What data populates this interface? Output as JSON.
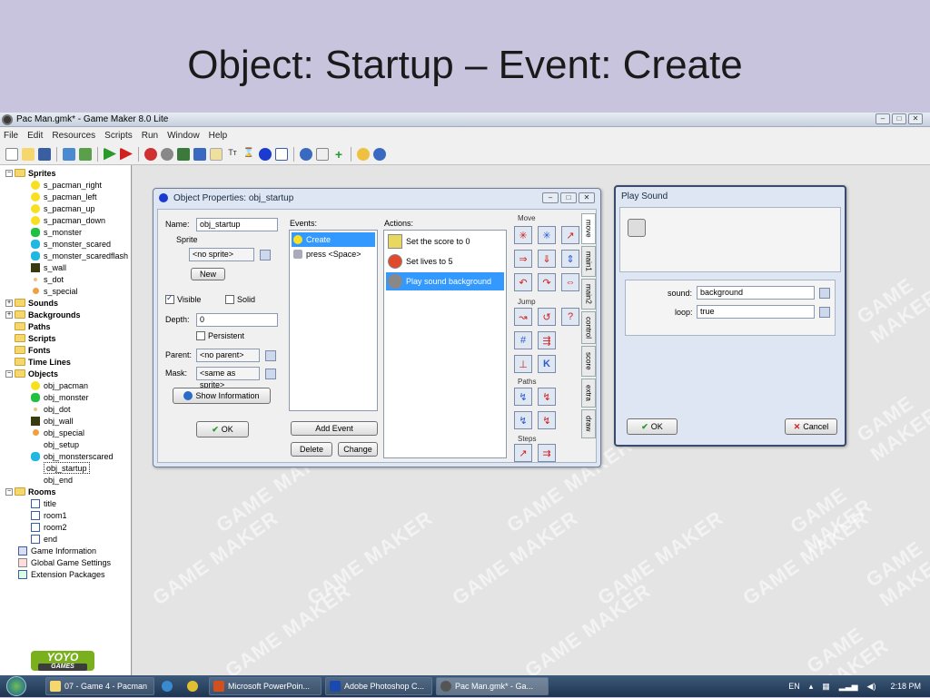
{
  "slide": {
    "title": "Object: Startup – Event: Create"
  },
  "window": {
    "title": "Pac Man.gmk* - Game Maker 8.0 Lite"
  },
  "menu": [
    "File",
    "Edit",
    "Resources",
    "Scripts",
    "Run",
    "Window",
    "Help"
  ],
  "tree": {
    "sprites_label": "Sprites",
    "sprites": [
      "s_pacman_right",
      "s_pacman_left",
      "s_pacman_up",
      "s_pacman_down",
      "s_monster",
      "s_monster_scared",
      "s_monster_scaredflash",
      "s_wall",
      "s_dot",
      "s_special"
    ],
    "sounds_label": "Sounds",
    "backgrounds_label": "Backgrounds",
    "paths_label": "Paths",
    "scripts_label": "Scripts",
    "fonts_label": "Fonts",
    "timelines_label": "Time Lines",
    "objects_label": "Objects",
    "objects": [
      "obj_pacman",
      "obj_monster",
      "obj_dot",
      "obj_wall",
      "obj_special",
      "obj_setup",
      "obj_monsterscared",
      "obj_startup",
      "obj_end"
    ],
    "rooms_label": "Rooms",
    "rooms": [
      "title",
      "room1",
      "room2",
      "end"
    ],
    "extras": [
      "Game Information",
      "Global Game Settings",
      "Extension Packages"
    ]
  },
  "objdlg": {
    "title": "Object Properties: obj_startup",
    "name_label": "Name:",
    "name_value": "obj_startup",
    "sprite_label": "Sprite",
    "sprite_value": "<no sprite>",
    "new_btn": "New",
    "visible_label": "Visible",
    "solid_label": "Solid",
    "depth_label": "Depth:",
    "depth_value": "0",
    "persistent_label": "Persistent",
    "parent_label": "Parent:",
    "parent_value": "<no parent>",
    "mask_label": "Mask:",
    "mask_value": "<same as sprite>",
    "show_info_btn": "Show Information",
    "ok_btn": "OK",
    "events_label": "Events:",
    "events": [
      "Create",
      "press <Space>"
    ],
    "add_event_btn": "Add Event",
    "delete_btn": "Delete",
    "change_btn": "Change",
    "actions_label": "Actions:",
    "actions": [
      "Set the score to 0",
      "Set lives to 5",
      "Play sound background"
    ],
    "palette_groups": [
      "Move",
      "Jump",
      "Paths",
      "Steps"
    ],
    "tabs": [
      "move",
      "main1",
      "main2",
      "control",
      "score",
      "extra",
      "draw"
    ]
  },
  "sounddlg": {
    "title": "Play Sound",
    "sound_label": "sound:",
    "sound_value": "background",
    "loop_label": "loop:",
    "loop_value": "true",
    "ok_btn": "OK",
    "cancel_btn": "Cancel"
  },
  "watermark": "GAME MAKER",
  "logo": {
    "top": "YOYO",
    "bottom": "GAMES"
  },
  "taskbar": {
    "tasks": [
      "07 - Game 4 - Pacman",
      "Microsoft PowerPoin...",
      "Adobe Photoshop C...",
      "Pac Man.gmk* - Ga..."
    ],
    "lang": "EN",
    "time": "2:18 PM"
  }
}
